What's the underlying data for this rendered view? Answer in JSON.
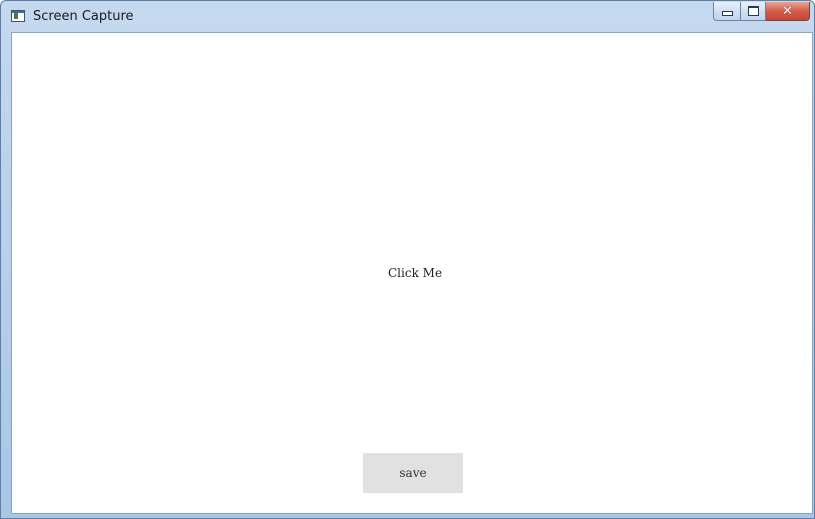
{
  "window": {
    "title": "Screen Capture",
    "icon": "app-window-icon",
    "controls": {
      "minimize": "minimize-icon",
      "maximize": "maximize-icon",
      "close": "close-icon"
    }
  },
  "content": {
    "click_label": "Click Me",
    "save_button_label": "save"
  },
  "colors": {
    "titlebar": "#b9d1ec",
    "close_button": "#c54632",
    "save_button_bg": "#e1e1e1",
    "client_bg": "#ffffff"
  }
}
